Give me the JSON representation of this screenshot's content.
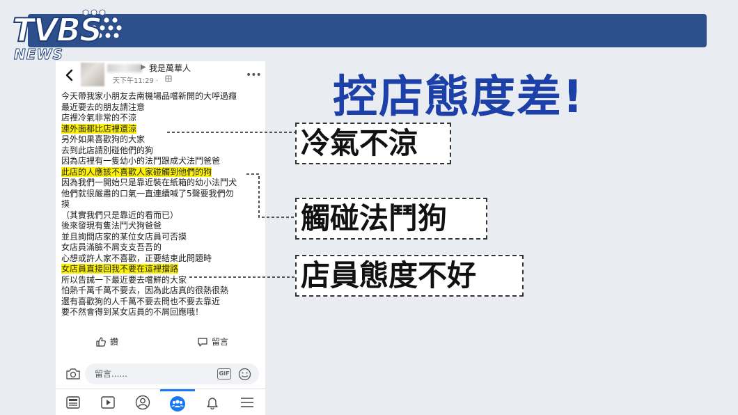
{
  "logo": {
    "brand": "TVBS",
    "sub": "NEWS"
  },
  "headline": "控店態度差!",
  "callouts": [
    "冷氣不涼",
    "觸碰法鬥狗",
    "店員態度不好"
  ],
  "post": {
    "group_name": "我是萬華人",
    "time": "天下午11:29 ·",
    "lines": [
      {
        "text": "今天帶我家小朋友去南機場品嚐新開的大呼過癮",
        "highlight": false
      },
      {
        "text": "最近要去的朋友請注意",
        "highlight": false
      },
      {
        "text": "店裡冷氣非常的不涼",
        "highlight": false
      },
      {
        "text": "連外面都比店裡還涼",
        "highlight": true
      },
      {
        "text": "另外如果喜歡狗的大家",
        "highlight": false
      },
      {
        "text": "去到此店請別碰他們的狗",
        "highlight": false
      },
      {
        "text": "因為店裡有一隻幼小的法鬥跟成犬法鬥爸爸",
        "highlight": false
      },
      {
        "text": "此店的人應該不喜歡人家碰觸到他們的狗",
        "highlight": true
      },
      {
        "text": "因為我們一開始只是靠近裝在紙箱的幼小法鬥犬",
        "highlight": false
      },
      {
        "text": "他們就很嚴肅的口氣一直連續喊了5聲要我們勿",
        "highlight": false
      },
      {
        "text": "摸",
        "highlight": false
      },
      {
        "text": "（其實我們只是靠近的看而已）",
        "highlight": false
      },
      {
        "text": "後來發現有隻法鬥犬狗爸爸",
        "highlight": false
      },
      {
        "text": "並且詢問店家的某位女店員可否摸",
        "highlight": false
      },
      {
        "text": "女店員滿臉不屑支支吾吾的",
        "highlight": false
      },
      {
        "text": "心想或許人家不喜歡，正要結束此問題時",
        "highlight": false
      },
      {
        "text": "女店員直接回我不要在這裡擋路",
        "highlight": true
      },
      {
        "text": "所以告誡一下最近要去嚐鮮的大家",
        "highlight": false
      },
      {
        "text": "怕熱千萬千萬不要去，因為此店真的很熱很熱",
        "highlight": false
      },
      {
        "text": "還有喜歡狗的人千萬不要去問也不要去靠近",
        "highlight": false
      },
      {
        "text": "要不然會得到某女店員的不屑回應哦！",
        "highlight": false
      }
    ],
    "like_label": "讚",
    "comment_label": "留言",
    "comment_placeholder": "留言......",
    "gif_label": "GIF"
  },
  "colors": {
    "highlight": "#fff200",
    "headline": "#1d3fa8",
    "banner": "#2d4f8c",
    "active_tab": "#1877f2"
  },
  "nav_icons": [
    "feed-icon",
    "video-icon",
    "profile-icon",
    "groups-icon",
    "bell-icon",
    "menu-icon"
  ]
}
